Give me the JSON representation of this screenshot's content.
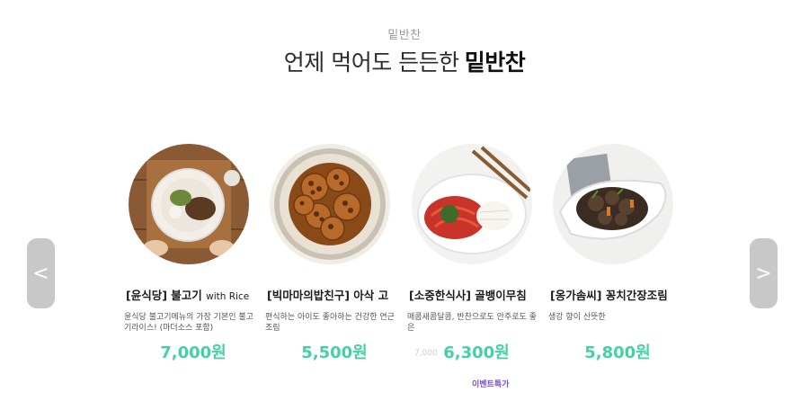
{
  "header": {
    "eyebrow": "밑반찬",
    "headline": "언제 먹어도 든든한",
    "headline_strong": "밑반찬"
  },
  "nav": {
    "prev_label": "<",
    "next_label": ">"
  },
  "products": [
    {
      "name": "[윤식당] 불고기",
      "name_suffix": "with Rice",
      "description": "윤식당 불고기메뉴의 가장 기본인 불고기라이스! (마더소스 포함)",
      "price": "7,000원",
      "original_price": "",
      "badge": ""
    },
    {
      "name": "[빅마마의밥친구] 아삭 고",
      "name_suffix": "",
      "description": "편식하는 아이도 좋아하는 건강한 연근조림",
      "price": "5,500원",
      "original_price": "",
      "badge": ""
    },
    {
      "name": "[소중한식사] 골뱅이무침",
      "name_suffix": "",
      "description": "매콤새콤달콤, 반찬으로도 안주로도 좋은",
      "price": "6,300원",
      "original_price": "7,000",
      "badge": "이벤트특가"
    },
    {
      "name": "[옹가솜씨] 꽁치간장조림",
      "name_suffix": "",
      "description": "생강 향이 산뜻한",
      "price": "5,800원",
      "original_price": "",
      "badge": ""
    }
  ],
  "colors": {
    "price": "#43d2a0",
    "badge": "#7a4fd0",
    "nav_button": "#c8c8c8"
  }
}
